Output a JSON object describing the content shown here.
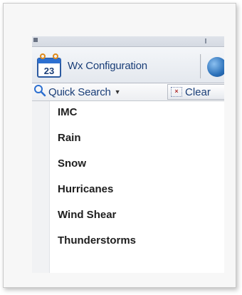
{
  "ribbon": {
    "wx_button_label": "Wx Configuration",
    "calendar_day": "23"
  },
  "search": {
    "quick_search_label": "Quick Search",
    "clear_label": "Clear"
  },
  "list": {
    "items": [
      {
        "label": "IMC"
      },
      {
        "label": "Rain"
      },
      {
        "label": "Snow"
      },
      {
        "label": "Hurricanes"
      },
      {
        "label": "Wind Shear"
      },
      {
        "label": "Thunderstorms"
      }
    ]
  },
  "icons": {
    "calendar": "calendar-icon",
    "globe": "globe-icon",
    "search": "search-icon",
    "dropdown": "chevron-down-icon",
    "clear": "clear-icon"
  },
  "colors": {
    "accent_text": "#1a3e78",
    "item_text": "#1e1e1e"
  }
}
